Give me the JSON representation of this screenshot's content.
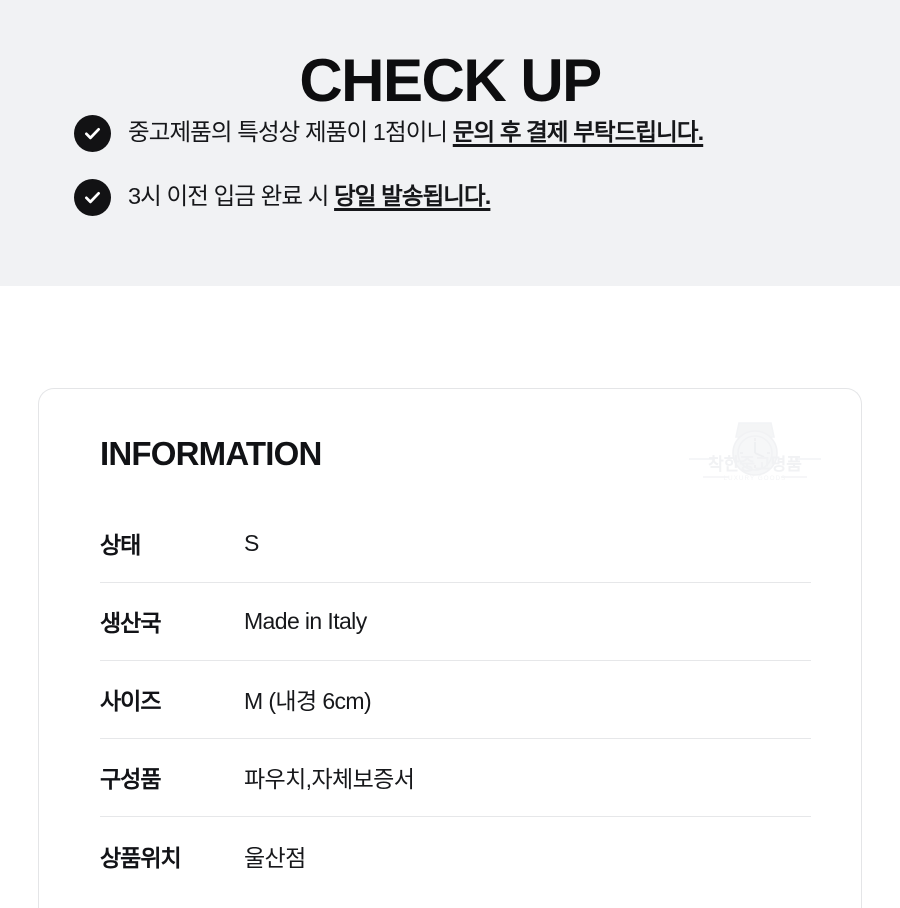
{
  "checkup": {
    "title": "CHECK UP",
    "items": [
      {
        "icon": "check-circle-icon",
        "text_plain": "중고제품의 특성상 제품이 1점이니 ",
        "text_emphasis": "문의 후 결제 부탁드립니다."
      },
      {
        "icon": "check-circle-icon",
        "text_plain": "3시 이전 입금 완료 시 ",
        "text_emphasis": "당일 발송됩니다."
      }
    ]
  },
  "information": {
    "heading": "INFORMATION",
    "watermark": {
      "icon": "wristwatch-icon",
      "brand": "착한중고명품",
      "tagline": "LUXURY GOODS"
    },
    "rows": [
      {
        "label": "상태",
        "value": "S"
      },
      {
        "label": "생산국",
        "value": "Made in Italy"
      },
      {
        "label": "사이즈",
        "value": "M (내경 6cm)"
      },
      {
        "label": "구성품",
        "value": "파우치,자체보증서"
      },
      {
        "label": "상품위치",
        "value": "울산점"
      }
    ]
  },
  "colors": {
    "panel_background": "#f1f2f4",
    "page_background": "#ffffff",
    "text_primary": "#121317",
    "icon_fill": "#121214",
    "icon_glyph": "#ffffff",
    "card_border": "#e4e5e7",
    "row_divider": "#e6e7e9",
    "watermark": "#f4f5f6"
  }
}
